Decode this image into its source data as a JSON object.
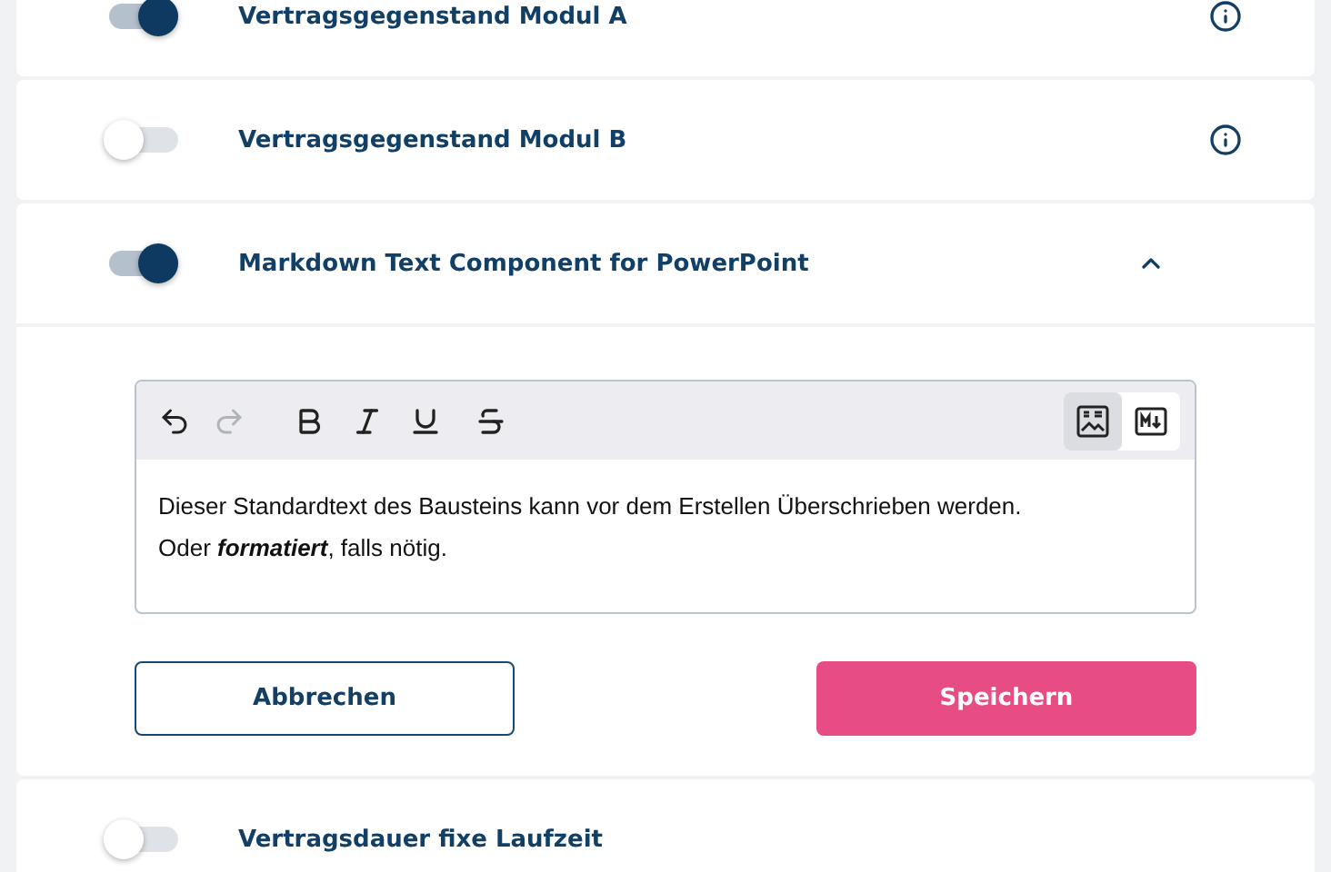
{
  "modules": [
    {
      "label": "Vertragsgegenstand Modul A",
      "on": true,
      "expanded": false,
      "info": true
    },
    {
      "label": "Vertragsgegenstand Modul B",
      "on": false,
      "expanded": false,
      "info": true
    },
    {
      "label": "Markdown Text Component for PowerPoint",
      "on": true,
      "expanded": true,
      "editor": {
        "history": [
          {
            "kind": "undo",
            "disabled": false
          },
          {
            "kind": "redo",
            "disabled": true
          }
        ],
        "formats": [
          {
            "kind": "bold"
          },
          {
            "kind": "italic"
          },
          {
            "kind": "underline"
          },
          {
            "kind": "strike"
          }
        ],
        "modes": [
          {
            "kind": "rich",
            "selected": true
          },
          {
            "kind": "markdown",
            "selected": false
          }
        ],
        "paragraphs": [
          "Dieser Standardtext des Bausteins kann vor dem Erstellen Überschrieben werden.",
          "Oder **formatiert**, falls nötig."
        ]
      },
      "buttons": [
        {
          "kind": "secondary",
          "label": "Abbrechen"
        },
        {
          "kind": "primary",
          "label": "Speichern"
        }
      ]
    },
    {
      "label": "Vertragsdauer fixe Laufzeit",
      "on": false,
      "expanded": false,
      "info": false
    }
  ]
}
